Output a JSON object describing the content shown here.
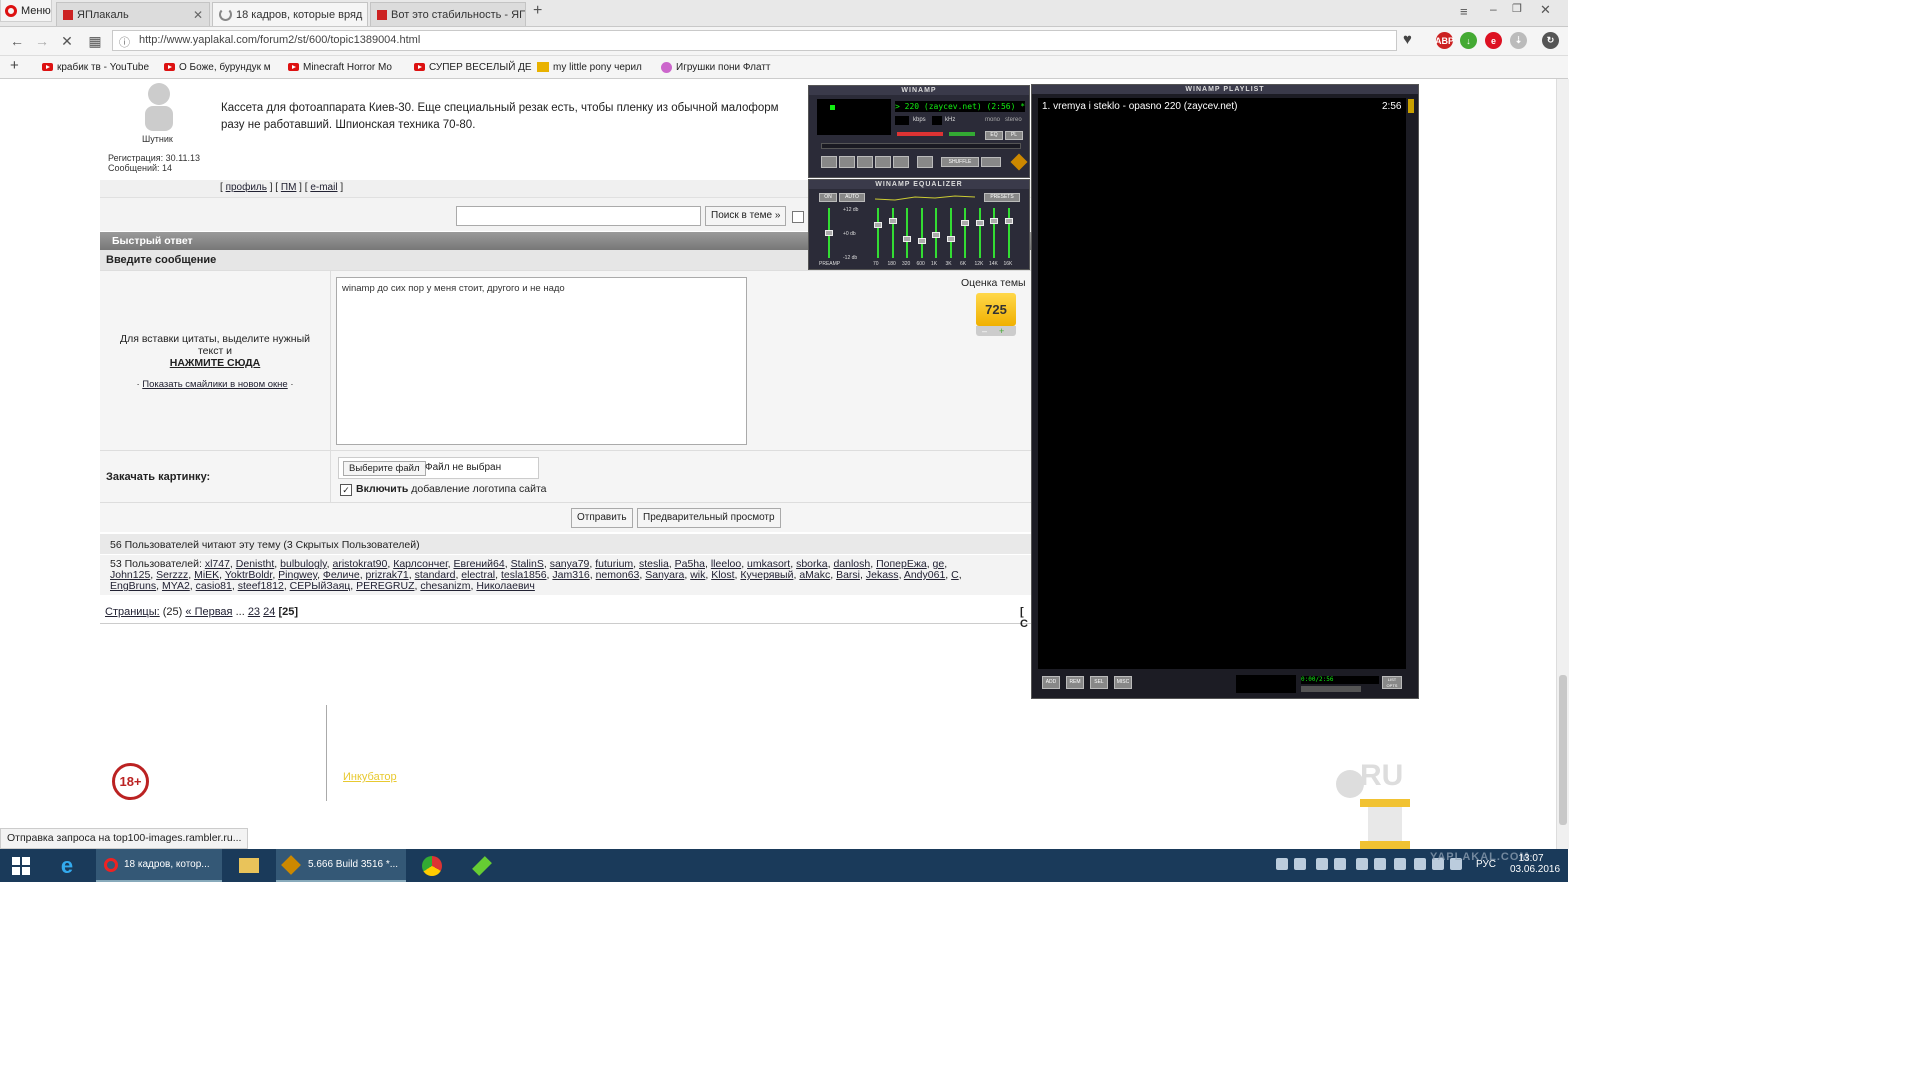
{
  "browser": {
    "menu_label": "Меню",
    "tabs": [
      {
        "label": "ЯПлакаль"
      },
      {
        "label": "18 кадров, которые вряд"
      },
      {
        "label": "Вот это стабильность - ЯП"
      }
    ],
    "new_tab": "+",
    "url": "http://www.yaplakal.com/forum2/st/600/topic1389004.html",
    "bookmarks": [
      {
        "label": "крабик тв - YouTube"
      },
      {
        "label": "О Боже, бурундук м"
      },
      {
        "label": "Minecraft Horror Mo"
      },
      {
        "label": "СУПЕР ВЕСЕЛЫЙ ДЕ"
      },
      {
        "label": "my little pony черил"
      },
      {
        "label": "Игрушки пони Флатт"
      }
    ],
    "ext_abp": "ABP",
    "status": "Отправка запроса на top100-images.rambler.ru..."
  },
  "forum": {
    "post": {
      "user_title": "Шутник",
      "reg_label": "Регистрация: 30.11.13",
      "msgs_label": "Сообщений: 14",
      "text_line1": "Кассета для фотоаппарата Киев-30. Еще специальный резак есть, чтобы пленку из обычной малоформ",
      "text_line2": "разу не работавший. Шпионская техника 70-80.",
      "profile_link": "профиль",
      "pm_link": "ПМ",
      "email_link": "e-mail"
    },
    "search_button": "Поиск в теме »",
    "quick_reply_header": "Быстрый ответ",
    "enter_message": "Введите сообщение",
    "quote_hint_1": "Для вставки цитаты, выделите нужный",
    "quote_hint_2": "текст и",
    "click_here": "НАЖМИТЕ СЮДА",
    "smilies_link": "Показать смайлики в новом окне",
    "message_text": "winamp до сих пор у меня стоит, другого и не надо",
    "rating_label": "Оценка темы",
    "rating_value": "725",
    "upload_label": "Закачать картинку:",
    "choose_file": "Выберите файл",
    "no_file": "Файл не выбран",
    "logo_bold": "Включить",
    "logo_rest": "добавление логотипа сайта",
    "send_button": "Отправить",
    "preview_button": "Предварительный просмотр",
    "readers_title": "56 Пользователей читают эту тему (3 Скрытых Пользователей)",
    "users_prefix": "53 Пользователей:",
    "users_line1": [
      "xl747",
      "Denistht",
      "bulbulogly",
      "aristokrat90",
      "Карлсончег",
      "Евгений64",
      "StalinS",
      "sanya79",
      "futurium",
      "steslia",
      "Pa5ha",
      "lleeloo",
      "umkasort",
      "sborka",
      "danlosh",
      "ПоперЕжа",
      "ge"
    ],
    "users_line2": [
      "John125",
      "Serzzz",
      "MiEK",
      "YoktrBoldr",
      "Pingwey",
      "Феличе",
      "prizrak71",
      "standard",
      "electral",
      "tesla1856",
      "Jam316",
      "nemon63",
      "Sanyara",
      "wik",
      "Klost",
      "Кучерявый",
      "aMakc",
      "Barsi",
      "Jekass",
      "Andy061",
      "C"
    ],
    "users_line3": [
      "EngBruns",
      "MYA2",
      "casio81",
      "steef1812",
      "СЕРЫйЗаяц",
      "PEREGRUZ",
      "chesanizm",
      "Николаевич"
    ],
    "pages_label": "Страницы:",
    "pages_count": "(25)",
    "first_page": "« Первая",
    "ellipsis": "...",
    "page_23": "23",
    "page_24": "24",
    "page_current": "[25]",
    "bracket_right": "[ C",
    "age_badge": "18+",
    "footer_link": "Инкубатор",
    "logo_text": "RU"
  },
  "winamp": {
    "main_title": "WINAMP",
    "song_scroll": "> 220 (zaycev.net) (2:56) *** 1. v",
    "kbps": "kbps",
    "khz": "kHz",
    "mono": "mono",
    "stereo": "stereo",
    "shuffle": "SHUFFLE",
    "eq_btn": "EQ",
    "pl_btn": "PL",
    "eq_title": "WINAMP EQUALIZER",
    "eq_on": "ON",
    "eq_auto": "AUTO",
    "eq_presets": "PRESETS",
    "eq_plus": "+12 db",
    "eq_zero": "+0 db",
    "eq_minus": "-12 db",
    "preamp": "PREAMP",
    "eq_bands": [
      "70",
      "180",
      "320",
      "600",
      "1K",
      "3K",
      "6K",
      "12K",
      "14K",
      "16K"
    ],
    "playlist_title": "WINAMP PLAYLIST",
    "playlist_item": "1. vremya i steklo - opasno 220 (zaycev.net)",
    "playlist_duration": "2:56",
    "pl_add": "ADD",
    "pl_rem": "REM",
    "pl_sel": "SEL",
    "pl_misc": "MISC",
    "pl_time": "0:00/2:56",
    "pl_list": "LIST OPTS"
  },
  "taskbar": {
    "opera_task": "18 кадров, котор...",
    "winamp_task": "5.666 Build 3516 *...",
    "lang": "РУС",
    "time": "13:07",
    "date": "03.06.2016",
    "watermark": "YAPLAKAL.COM"
  }
}
